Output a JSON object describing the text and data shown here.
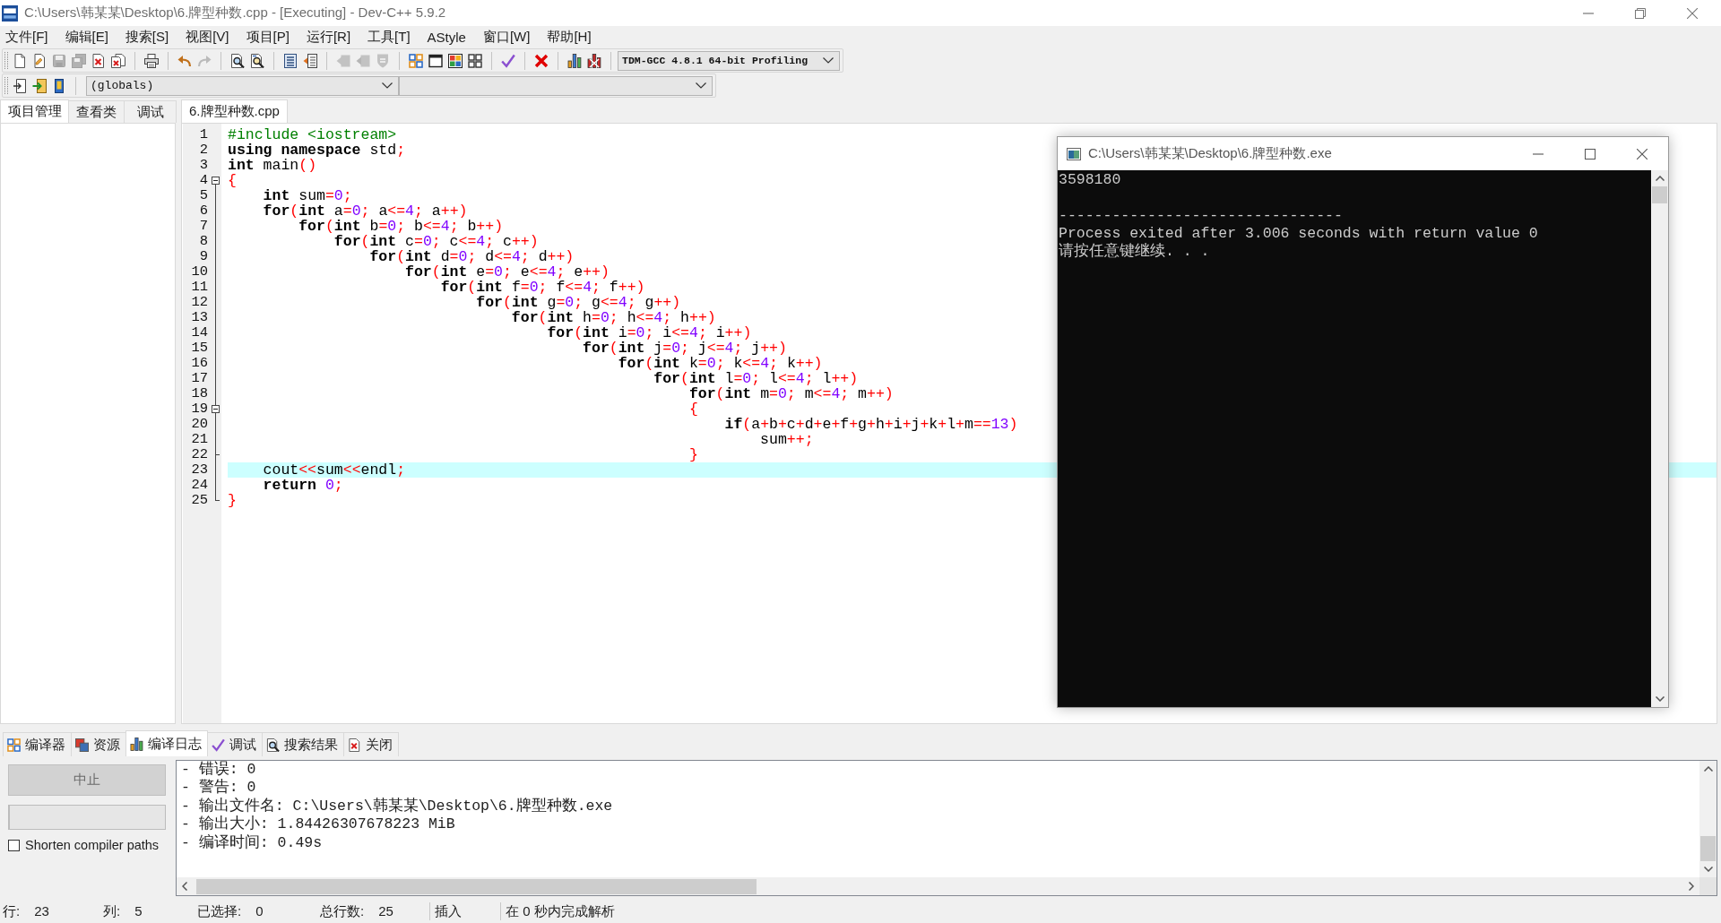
{
  "window": {
    "title": "C:\\Users\\韩某某\\Desktop\\6.牌型种数.cpp - [Executing] - Dev-C++ 5.9.2"
  },
  "menu": [
    "文件[F]",
    "编辑[E]",
    "搜索[S]",
    "视图[V]",
    "项目[P]",
    "运行[R]",
    "工具[T]",
    "AStyle",
    "窗口[W]",
    "帮助[H]"
  ],
  "toolbar": {
    "groups": [
      [
        {
          "kind": "new",
          "disabled": false
        },
        {
          "kind": "open",
          "disabled": false
        },
        {
          "kind": "save",
          "disabled": true
        },
        {
          "kind": "save-all",
          "disabled": true
        },
        {
          "kind": "close",
          "disabled": false
        },
        {
          "kind": "close-all",
          "disabled": false
        }
      ],
      [
        {
          "kind": "print",
          "disabled": false
        }
      ],
      [
        {
          "kind": "undo",
          "disabled": false
        },
        {
          "kind": "redo",
          "disabled": true
        }
      ],
      [
        {
          "kind": "find",
          "disabled": false
        },
        {
          "kind": "replace",
          "disabled": false
        }
      ],
      [
        {
          "kind": "indent",
          "disabled": false
        },
        {
          "kind": "unindent",
          "disabled": false
        }
      ],
      [
        {
          "kind": "prev-bookmark",
          "disabled": true
        },
        {
          "kind": "next-bookmark",
          "disabled": true
        },
        {
          "kind": "comment",
          "disabled": true
        }
      ],
      [
        {
          "kind": "compile",
          "disabled": false
        },
        {
          "kind": "run",
          "disabled": false
        },
        {
          "kind": "compile-run",
          "disabled": false
        },
        {
          "kind": "rebuild",
          "disabled": false
        }
      ],
      [
        {
          "kind": "check",
          "disabled": false
        }
      ],
      [
        {
          "kind": "stop",
          "disabled": false
        }
      ],
      [
        {
          "kind": "profile",
          "disabled": false
        },
        {
          "kind": "delete-profile",
          "disabled": false
        }
      ]
    ],
    "compiler": "TDM-GCC 4.8.1 64-bit Profiling"
  },
  "class_bar": {
    "scope": "(globals)"
  },
  "left_panel": {
    "tabs": [
      {
        "label": "项目管理",
        "selected": true
      },
      {
        "label": "查看类",
        "selected": false
      },
      {
        "label": "调试",
        "selected": false
      }
    ]
  },
  "editor": {
    "tabs": [
      {
        "label": "6.牌型种数.cpp",
        "selected": true
      }
    ],
    "lines": [
      {
        "number": "1",
        "kind": "plain",
        "current": false,
        "tokens": [
          {
            "kind": "pre",
            "text": "#include <iostream>"
          }
        ]
      },
      {
        "number": "2",
        "kind": "plain",
        "current": false,
        "tokens": [
          {
            "kind": "kw",
            "text": "using namespace"
          },
          {
            "kind": "id",
            "text": " std"
          },
          {
            "kind": "op",
            "text": ";"
          }
        ]
      },
      {
        "number": "3",
        "kind": "plain",
        "current": false,
        "tokens": [
          {
            "kind": "kw",
            "text": "int"
          },
          {
            "kind": "id",
            "text": " main"
          },
          {
            "kind": "op",
            "text": "()"
          }
        ]
      },
      {
        "number": "4",
        "kind": "fold-open",
        "current": false,
        "tokens": [
          {
            "kind": "op",
            "text": "{"
          }
        ]
      },
      {
        "number": "5",
        "kind": "fold-line",
        "current": false,
        "tokens": [
          {
            "kind": "kw",
            "text": "\tint"
          },
          {
            "kind": "id",
            "text": " sum"
          },
          {
            "kind": "op",
            "text": "="
          },
          {
            "kind": "num",
            "text": "0"
          },
          {
            "kind": "op",
            "text": ";"
          }
        ]
      },
      {
        "number": "6",
        "kind": "fold-line",
        "current": false,
        "tokens": [
          {
            "kind": "kw",
            "text": "\tfor"
          },
          {
            "kind": "op",
            "text": "("
          },
          {
            "kind": "kw",
            "text": "int"
          },
          {
            "kind": "id",
            "text": " a"
          },
          {
            "kind": "op",
            "text": "="
          },
          {
            "kind": "num",
            "text": "0"
          },
          {
            "kind": "op",
            "text": ";"
          },
          {
            "kind": "id",
            "text": " a"
          },
          {
            "kind": "op",
            "text": "<="
          },
          {
            "kind": "num",
            "text": "4"
          },
          {
            "kind": "op",
            "text": ";"
          },
          {
            "kind": "id",
            "text": " a"
          },
          {
            "kind": "op",
            "text": "++)"
          }
        ]
      },
      {
        "number": "7",
        "kind": "fold-line",
        "current": false,
        "tokens": [
          {
            "kind": "kw",
            "text": "\t\tfor"
          },
          {
            "kind": "op",
            "text": "("
          },
          {
            "kind": "kw",
            "text": "int"
          },
          {
            "kind": "id",
            "text": " b"
          },
          {
            "kind": "op",
            "text": "="
          },
          {
            "kind": "num",
            "text": "0"
          },
          {
            "kind": "op",
            "text": ";"
          },
          {
            "kind": "id",
            "text": " b"
          },
          {
            "kind": "op",
            "text": "<="
          },
          {
            "kind": "num",
            "text": "4"
          },
          {
            "kind": "op",
            "text": ";"
          },
          {
            "kind": "id",
            "text": " b"
          },
          {
            "kind": "op",
            "text": "++)"
          }
        ]
      },
      {
        "number": "8",
        "kind": "fold-line",
        "current": false,
        "tokens": [
          {
            "kind": "kw",
            "text": "\t\t\tfor"
          },
          {
            "kind": "op",
            "text": "("
          },
          {
            "kind": "kw",
            "text": "int"
          },
          {
            "kind": "id",
            "text": " c"
          },
          {
            "kind": "op",
            "text": "="
          },
          {
            "kind": "num",
            "text": "0"
          },
          {
            "kind": "op",
            "text": ";"
          },
          {
            "kind": "id",
            "text": " c"
          },
          {
            "kind": "op",
            "text": "<="
          },
          {
            "kind": "num",
            "text": "4"
          },
          {
            "kind": "op",
            "text": ";"
          },
          {
            "kind": "id",
            "text": " c"
          },
          {
            "kind": "op",
            "text": "++)"
          }
        ]
      },
      {
        "number": "9",
        "kind": "fold-line",
        "current": false,
        "tokens": [
          {
            "kind": "kw",
            "text": "\t\t\t\tfor"
          },
          {
            "kind": "op",
            "text": "("
          },
          {
            "kind": "kw",
            "text": "int"
          },
          {
            "kind": "id",
            "text": " d"
          },
          {
            "kind": "op",
            "text": "="
          },
          {
            "kind": "num",
            "text": "0"
          },
          {
            "kind": "op",
            "text": ";"
          },
          {
            "kind": "id",
            "text": " d"
          },
          {
            "kind": "op",
            "text": "<="
          },
          {
            "kind": "num",
            "text": "4"
          },
          {
            "kind": "op",
            "text": ";"
          },
          {
            "kind": "id",
            "text": " d"
          },
          {
            "kind": "op",
            "text": "++)"
          }
        ]
      },
      {
        "number": "10",
        "kind": "fold-line",
        "current": false,
        "tokens": [
          {
            "kind": "kw",
            "text": "\t\t\t\t\tfor"
          },
          {
            "kind": "op",
            "text": "("
          },
          {
            "kind": "kw",
            "text": "int"
          },
          {
            "kind": "id",
            "text": " e"
          },
          {
            "kind": "op",
            "text": "="
          },
          {
            "kind": "num",
            "text": "0"
          },
          {
            "kind": "op",
            "text": ";"
          },
          {
            "kind": "id",
            "text": " e"
          },
          {
            "kind": "op",
            "text": "<="
          },
          {
            "kind": "num",
            "text": "4"
          },
          {
            "kind": "op",
            "text": ";"
          },
          {
            "kind": "id",
            "text": " e"
          },
          {
            "kind": "op",
            "text": "++)"
          }
        ]
      },
      {
        "number": "11",
        "kind": "fold-line",
        "current": false,
        "tokens": [
          {
            "kind": "kw",
            "text": "\t\t\t\t\t\tfor"
          },
          {
            "kind": "op",
            "text": "("
          },
          {
            "kind": "kw",
            "text": "int"
          },
          {
            "kind": "id",
            "text": " f"
          },
          {
            "kind": "op",
            "text": "="
          },
          {
            "kind": "num",
            "text": "0"
          },
          {
            "kind": "op",
            "text": ";"
          },
          {
            "kind": "id",
            "text": " f"
          },
          {
            "kind": "op",
            "text": "<="
          },
          {
            "kind": "num",
            "text": "4"
          },
          {
            "kind": "op",
            "text": ";"
          },
          {
            "kind": "id",
            "text": " f"
          },
          {
            "kind": "op",
            "text": "++)"
          }
        ]
      },
      {
        "number": "12",
        "kind": "fold-line",
        "current": false,
        "tokens": [
          {
            "kind": "kw",
            "text": "\t\t\t\t\t\t\tfor"
          },
          {
            "kind": "op",
            "text": "("
          },
          {
            "kind": "kw",
            "text": "int"
          },
          {
            "kind": "id",
            "text": " g"
          },
          {
            "kind": "op",
            "text": "="
          },
          {
            "kind": "num",
            "text": "0"
          },
          {
            "kind": "op",
            "text": ";"
          },
          {
            "kind": "id",
            "text": " g"
          },
          {
            "kind": "op",
            "text": "<="
          },
          {
            "kind": "num",
            "text": "4"
          },
          {
            "kind": "op",
            "text": ";"
          },
          {
            "kind": "id",
            "text": " g"
          },
          {
            "kind": "op",
            "text": "++)"
          }
        ]
      },
      {
        "number": "13",
        "kind": "fold-line",
        "current": false,
        "tokens": [
          {
            "kind": "kw",
            "text": "\t\t\t\t\t\t\t\tfor"
          },
          {
            "kind": "op",
            "text": "("
          },
          {
            "kind": "kw",
            "text": "int"
          },
          {
            "kind": "id",
            "text": " h"
          },
          {
            "kind": "op",
            "text": "="
          },
          {
            "kind": "num",
            "text": "0"
          },
          {
            "kind": "op",
            "text": ";"
          },
          {
            "kind": "id",
            "text": " h"
          },
          {
            "kind": "op",
            "text": "<="
          },
          {
            "kind": "num",
            "text": "4"
          },
          {
            "kind": "op",
            "text": ";"
          },
          {
            "kind": "id",
            "text": " h"
          },
          {
            "kind": "op",
            "text": "++)"
          }
        ]
      },
      {
        "number": "14",
        "kind": "fold-line",
        "current": false,
        "tokens": [
          {
            "kind": "kw",
            "text": "\t\t\t\t\t\t\t\t\tfor"
          },
          {
            "kind": "op",
            "text": "("
          },
          {
            "kind": "kw",
            "text": "int"
          },
          {
            "kind": "id",
            "text": " i"
          },
          {
            "kind": "op",
            "text": "="
          },
          {
            "kind": "num",
            "text": "0"
          },
          {
            "kind": "op",
            "text": ";"
          },
          {
            "kind": "id",
            "text": " i"
          },
          {
            "kind": "op",
            "text": "<="
          },
          {
            "kind": "num",
            "text": "4"
          },
          {
            "kind": "op",
            "text": ";"
          },
          {
            "kind": "id",
            "text": " i"
          },
          {
            "kind": "op",
            "text": "++)"
          }
        ]
      },
      {
        "number": "15",
        "kind": "fold-line",
        "current": false,
        "tokens": [
          {
            "kind": "kw",
            "text": "\t\t\t\t\t\t\t\t\t\tfor"
          },
          {
            "kind": "op",
            "text": "("
          },
          {
            "kind": "kw",
            "text": "int"
          },
          {
            "kind": "id",
            "text": " j"
          },
          {
            "kind": "op",
            "text": "="
          },
          {
            "kind": "num",
            "text": "0"
          },
          {
            "kind": "op",
            "text": ";"
          },
          {
            "kind": "id",
            "text": " j"
          },
          {
            "kind": "op",
            "text": "<="
          },
          {
            "kind": "num",
            "text": "4"
          },
          {
            "kind": "op",
            "text": ";"
          },
          {
            "kind": "id",
            "text": " j"
          },
          {
            "kind": "op",
            "text": "++)"
          }
        ]
      },
      {
        "number": "16",
        "kind": "fold-line",
        "current": false,
        "tokens": [
          {
            "kind": "kw",
            "text": "\t\t\t\t\t\t\t\t\t\t\tfor"
          },
          {
            "kind": "op",
            "text": "("
          },
          {
            "kind": "kw",
            "text": "int"
          },
          {
            "kind": "id",
            "text": " k"
          },
          {
            "kind": "op",
            "text": "="
          },
          {
            "kind": "num",
            "text": "0"
          },
          {
            "kind": "op",
            "text": ";"
          },
          {
            "kind": "id",
            "text": " k"
          },
          {
            "kind": "op",
            "text": "<="
          },
          {
            "kind": "num",
            "text": "4"
          },
          {
            "kind": "op",
            "text": ";"
          },
          {
            "kind": "id",
            "text": " k"
          },
          {
            "kind": "op",
            "text": "++)"
          }
        ]
      },
      {
        "number": "17",
        "kind": "fold-line",
        "current": false,
        "tokens": [
          {
            "kind": "kw",
            "text": "\t\t\t\t\t\t\t\t\t\t\t\tfor"
          },
          {
            "kind": "op",
            "text": "("
          },
          {
            "kind": "kw",
            "text": "int"
          },
          {
            "kind": "id",
            "text": " l"
          },
          {
            "kind": "op",
            "text": "="
          },
          {
            "kind": "num",
            "text": "0"
          },
          {
            "kind": "op",
            "text": ";"
          },
          {
            "kind": "id",
            "text": " l"
          },
          {
            "kind": "op",
            "text": "<="
          },
          {
            "kind": "num",
            "text": "4"
          },
          {
            "kind": "op",
            "text": ";"
          },
          {
            "kind": "id",
            "text": " l"
          },
          {
            "kind": "op",
            "text": "++)"
          }
        ]
      },
      {
        "number": "18",
        "kind": "fold-line",
        "current": false,
        "tokens": [
          {
            "kind": "kw",
            "text": "\t\t\t\t\t\t\t\t\t\t\t\t\tfor"
          },
          {
            "kind": "op",
            "text": "("
          },
          {
            "kind": "kw",
            "text": "int"
          },
          {
            "kind": "id",
            "text": " m"
          },
          {
            "kind": "op",
            "text": "="
          },
          {
            "kind": "num",
            "text": "0"
          },
          {
            "kind": "op",
            "text": ";"
          },
          {
            "kind": "id",
            "text": " m"
          },
          {
            "kind": "op",
            "text": "<="
          },
          {
            "kind": "num",
            "text": "4"
          },
          {
            "kind": "op",
            "text": ";"
          },
          {
            "kind": "id",
            "text": " m"
          },
          {
            "kind": "op",
            "text": "++)"
          }
        ]
      },
      {
        "number": "19",
        "kind": "fold-open-nested",
        "current": false,
        "tokens": [
          {
            "kind": "op",
            "text": "\t\t\t\t\t\t\t\t\t\t\t\t\t{"
          }
        ]
      },
      {
        "number": "20",
        "kind": "fold-line",
        "current": false,
        "tokens": [
          {
            "kind": "kw",
            "text": "\t\t\t\t\t\t\t\t\t\t\t\t\t\tif"
          },
          {
            "kind": "op",
            "text": "("
          },
          {
            "kind": "id",
            "text": "a"
          },
          {
            "kind": "op",
            "text": "+"
          },
          {
            "kind": "id",
            "text": "b"
          },
          {
            "kind": "op",
            "text": "+"
          },
          {
            "kind": "id",
            "text": "c"
          },
          {
            "kind": "op",
            "text": "+"
          },
          {
            "kind": "id",
            "text": "d"
          },
          {
            "kind": "op",
            "text": "+"
          },
          {
            "kind": "id",
            "text": "e"
          },
          {
            "kind": "op",
            "text": "+"
          },
          {
            "kind": "id",
            "text": "f"
          },
          {
            "kind": "op",
            "text": "+"
          },
          {
            "kind": "id",
            "text": "g"
          },
          {
            "kind": "op",
            "text": "+"
          },
          {
            "kind": "id",
            "text": "h"
          },
          {
            "kind": "op",
            "text": "+"
          },
          {
            "kind": "id",
            "text": "i"
          },
          {
            "kind": "op",
            "text": "+"
          },
          {
            "kind": "id",
            "text": "j"
          },
          {
            "kind": "op",
            "text": "+"
          },
          {
            "kind": "id",
            "text": "k"
          },
          {
            "kind": "op",
            "text": "+"
          },
          {
            "kind": "id",
            "text": "l"
          },
          {
            "kind": "op",
            "text": "+"
          },
          {
            "kind": "id",
            "text": "m"
          },
          {
            "kind": "op",
            "text": "=="
          },
          {
            "kind": "num",
            "text": "13"
          },
          {
            "kind": "op",
            "text": ")"
          }
        ]
      },
      {
        "number": "21",
        "kind": "fold-line",
        "current": false,
        "tokens": [
          {
            "kind": "id",
            "text": "\t\t\t\t\t\t\t\t\t\t\t\t\t\t\tsum"
          },
          {
            "kind": "op",
            "text": "++;"
          }
        ]
      },
      {
        "number": "22",
        "kind": "fold-close-nested",
        "current": false,
        "tokens": [
          {
            "kind": "op",
            "text": "\t\t\t\t\t\t\t\t\t\t\t\t\t}"
          }
        ]
      },
      {
        "number": "23",
        "kind": "fold-line",
        "current": true,
        "tokens": [
          {
            "kind": "id",
            "text": "\tcout"
          },
          {
            "kind": "op",
            "text": "<<"
          },
          {
            "kind": "id",
            "text": "sum"
          },
          {
            "kind": "op",
            "text": "<<"
          },
          {
            "kind": "id",
            "text": "endl"
          },
          {
            "kind": "op",
            "text": ";"
          }
        ]
      },
      {
        "number": "24",
        "kind": "fold-line",
        "current": false,
        "tokens": [
          {
            "kind": "kw",
            "text": "\treturn "
          },
          {
            "kind": "num",
            "text": "0"
          },
          {
            "kind": "op",
            "text": ";"
          }
        ]
      },
      {
        "number": "25",
        "kind": "fold-close",
        "current": false,
        "tokens": [
          {
            "kind": "op",
            "text": "}"
          }
        ]
      }
    ]
  },
  "console": {
    "title": "C:\\Users\\韩某某\\Desktop\\6.牌型种数.exe",
    "output": "3598180",
    "separator": "--------------------------------",
    "exit_message": "Process exited after 3.006 seconds with return value 0",
    "prompt": "请按任意键继续. . ."
  },
  "bottom_panel": {
    "tabs": [
      {
        "kind": "compiler",
        "label": "编译器",
        "selected": false
      },
      {
        "kind": "resources",
        "label": "资源",
        "selected": false
      },
      {
        "kind": "log",
        "label": "编译日志",
        "selected": true
      },
      {
        "kind": "debug",
        "label": "调试",
        "selected": false
      },
      {
        "kind": "search",
        "label": "搜索结果",
        "selected": false
      },
      {
        "kind": "close",
        "label": "关闭",
        "selected": false
      }
    ],
    "abort_button": {
      "label": "中止",
      "disabled": true
    },
    "progress": {
      "level": 0
    },
    "shorten_paths": {
      "label": "Shorten compiler paths",
      "checked": false
    },
    "log": [
      "- 错误: 0",
      "- 警告: 0",
      "- 输出文件名: C:\\Users\\韩某某\\Desktop\\6.牌型种数.exe",
      "- 输出大小: 1.84426307678223 MiB",
      "- 编译时间: 0.49s"
    ]
  },
  "status_bar": {
    "fields": [
      {
        "label": "行:",
        "value": "23"
      },
      {
        "label": "列:",
        "value": "5"
      },
      {
        "label": "已选择:",
        "value": "0"
      },
      {
        "label": "总行数:",
        "value": "25"
      }
    ],
    "mode": "插入",
    "message": "在 0 秒内完成解析"
  }
}
